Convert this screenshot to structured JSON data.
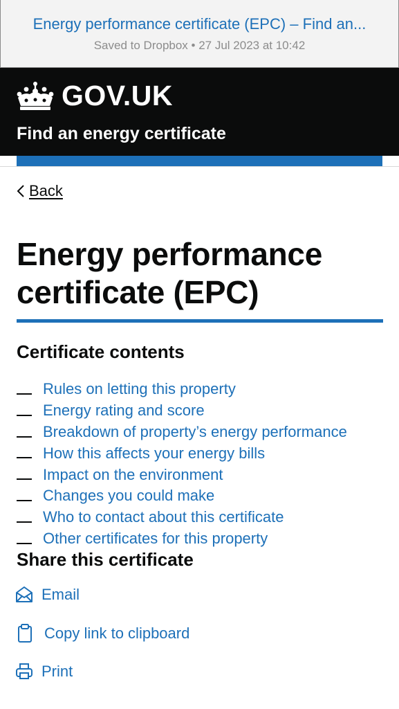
{
  "browser": {
    "page_title": "Energy performance certificate (EPC) – Find an...",
    "saved_info": "Saved to Dropbox • 27 Jul 2023 at 10:42"
  },
  "header": {
    "brand": "GOV.UK",
    "service_name": "Find an energy certificate",
    "brand_color": "#0b0c0c",
    "accent_color": "#1d70b8"
  },
  "back_link": {
    "label": "Back",
    "icon": "chevron-left-icon"
  },
  "page": {
    "title": "Energy performance certificate (EPC)"
  },
  "contents": {
    "heading": "Certificate contents",
    "items": [
      {
        "label": "Rules on letting this property"
      },
      {
        "label": "Energy rating and score"
      },
      {
        "label": "Breakdown of property’s energy performance"
      },
      {
        "label": "How this affects your energy bills"
      },
      {
        "label": "Impact on the environment"
      },
      {
        "label": "Changes you could make"
      },
      {
        "label": "Who to contact about this certificate"
      },
      {
        "label": "Other certificates for this property"
      }
    ]
  },
  "share": {
    "heading": "Share this certificate",
    "email_label": "Email",
    "copy_label": "Copy link to clipboard",
    "print_label": "Print",
    "icons": [
      "envelope-icon",
      "clipboard-icon",
      "printer-icon"
    ]
  }
}
